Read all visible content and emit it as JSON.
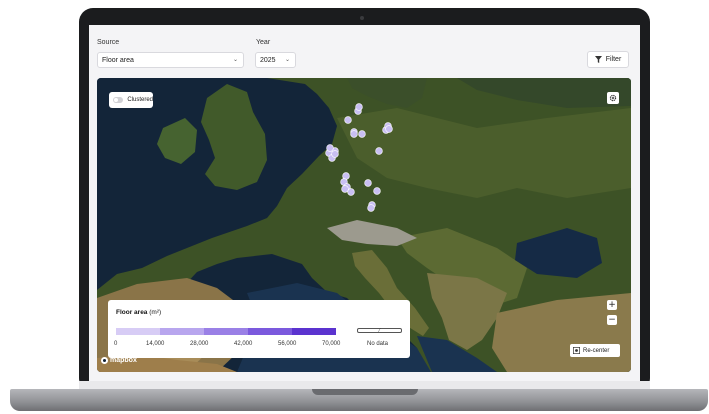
{
  "source": {
    "label": "Source",
    "value": "Floor area"
  },
  "year": {
    "label": "Year",
    "value": "2025"
  },
  "filter_button": {
    "label": "Filter",
    "icon": "filter-icon"
  },
  "map": {
    "cluster_toggle": {
      "label": "Clustered",
      "on": false
    },
    "settings_icon": "gear-icon",
    "zoom_in": "+",
    "zoom_out": "−",
    "recenter": {
      "label": "Re-center",
      "icon": "recenter-icon"
    },
    "attribution": "mapbox",
    "marker_color": "#c9bff3"
  },
  "legend": {
    "title": "Floor area",
    "unit": "(m²)",
    "ticks": [
      "0",
      "14,000",
      "28,000",
      "42,000",
      "56,000",
      "70,000"
    ],
    "no_data_label": "No data",
    "colors": [
      "#d7ccf5",
      "#b8a6ee",
      "#9a80e6",
      "#7b59dd",
      "#5b33cf"
    ]
  }
}
